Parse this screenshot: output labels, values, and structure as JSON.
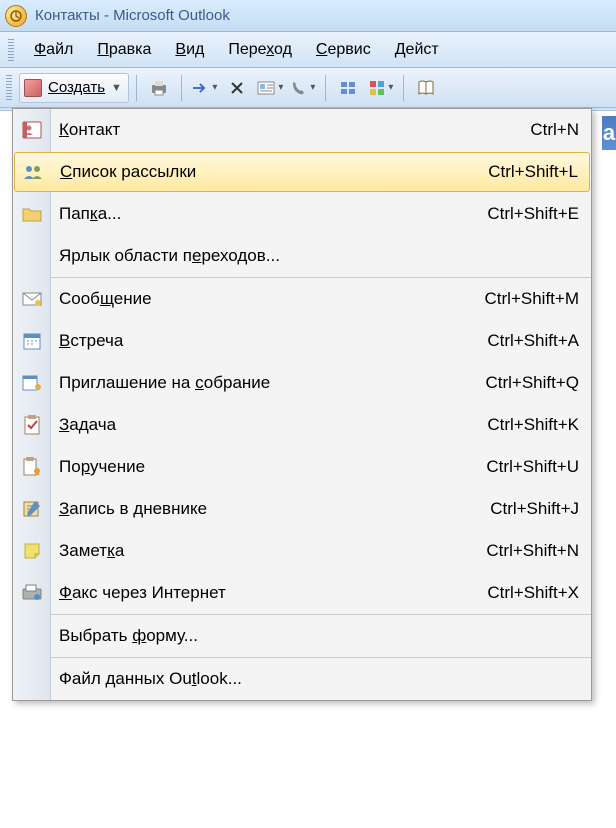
{
  "title": "Контакты - Microsoft Outlook",
  "menubar": [
    "Файл",
    "Правка",
    "Вид",
    "Переход",
    "Сервис",
    "Дейст"
  ],
  "menubar_underline_index": [
    0,
    0,
    0,
    4,
    0,
    0
  ],
  "create_button": "Создать",
  "toolbar_icons": [
    "print-icon",
    "arrow-icon",
    "delete-icon",
    "card-icon",
    "phone-icon",
    "view-icon",
    "apps-icon",
    "categorize-icon",
    "book-icon"
  ],
  "dropdown": {
    "sections": [
      [
        {
          "icon": "contact-icon",
          "label": "Контакт",
          "underline": 0,
          "shortcut": "Ctrl+N"
        },
        {
          "icon": "list-icon",
          "label": "Список рассылки",
          "underline": 0,
          "shortcut": "Ctrl+Shift+L",
          "highlight": true
        },
        {
          "icon": "folder-icon",
          "label": "Папка...",
          "underline": 3,
          "shortcut": "Ctrl+Shift+E"
        },
        {
          "icon": "",
          "label": "Ярлык области переходов...",
          "underline": 15,
          "shortcut": ""
        }
      ],
      [
        {
          "icon": "mail-icon",
          "label": "Сообщение",
          "underline": 4,
          "shortcut": "Ctrl+Shift+M"
        },
        {
          "icon": "calendar-icon",
          "label": "Встреча",
          "underline": 0,
          "shortcut": "Ctrl+Shift+A"
        },
        {
          "icon": "meeting-icon",
          "label": "Приглашение на собрание",
          "underline": 15,
          "shortcut": "Ctrl+Shift+Q"
        },
        {
          "icon": "task-icon",
          "label": "Задача",
          "underline": 0,
          "shortcut": "Ctrl+Shift+K"
        },
        {
          "icon": "assign-icon",
          "label": "Поручение",
          "underline": 2,
          "shortcut": "Ctrl+Shift+U"
        },
        {
          "icon": "journal-icon",
          "label": "Запись в дневнике",
          "underline": 0,
          "shortcut": "Ctrl+Shift+J"
        },
        {
          "icon": "note-icon",
          "label": "Заметка",
          "underline": 5,
          "shortcut": "Ctrl+Shift+N"
        },
        {
          "icon": "fax-icon",
          "label": "Факс через Интернет",
          "underline": 0,
          "shortcut": "Ctrl+Shift+X"
        }
      ],
      [
        {
          "icon": "",
          "label": "Выбрать форму...",
          "underline": 8,
          "shortcut": ""
        }
      ],
      [
        {
          "icon": "",
          "label": "Файл данных Outlook...",
          "underline": 14,
          "shortcut": ""
        }
      ]
    ]
  }
}
